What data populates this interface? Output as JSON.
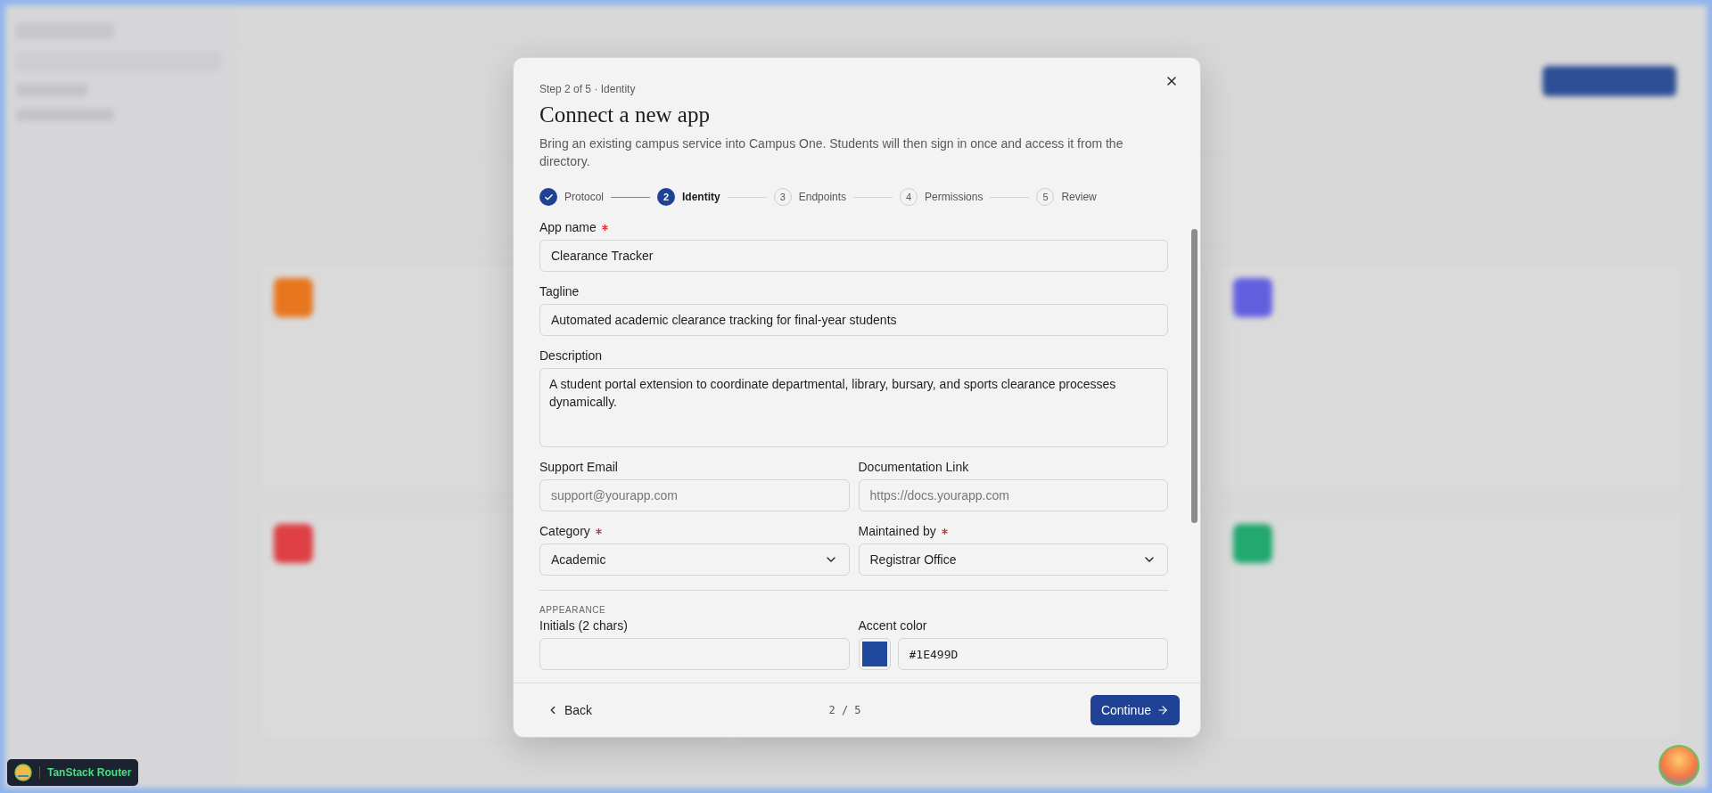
{
  "modal": {
    "step_label": "Step 2 of 5 · Identity",
    "title": "Connect a new app",
    "description": "Bring an existing campus service into Campus One. Students will then sign in once and access it from the directory.",
    "steps": [
      {
        "label": "Protocol",
        "done": true,
        "selected": false
      },
      {
        "number": "2",
        "label": "Identity",
        "done": false,
        "selected": true
      },
      {
        "number": "3",
        "label": "Endpoints",
        "done": false,
        "selected": false
      },
      {
        "number": "4",
        "label": "Permissions",
        "done": false,
        "selected": false
      },
      {
        "number": "5",
        "label": "Review",
        "done": false,
        "selected": false
      }
    ],
    "rows": [
      [
        {
          "kind": "text",
          "label": "App name",
          "required": true,
          "value": "Clearance Tracker"
        }
      ],
      [
        {
          "kind": "text",
          "label": "Tagline",
          "required": false,
          "value": "Automated academic clearance tracking for final-year students"
        }
      ],
      [
        {
          "kind": "textarea",
          "label": "Description",
          "required": false,
          "value": "A student portal extension to coordinate departmental, library, bursary, and sports clearance processes dynamically."
        }
      ],
      [
        {
          "kind": "text",
          "label": "Support Email",
          "required": false,
          "placeholder": "support@yourapp.com"
        },
        {
          "kind": "text",
          "label": "Documentation Link",
          "required": false,
          "placeholder": "https://docs.yourapp.com"
        }
      ],
      [
        {
          "kind": "select",
          "label": "Category",
          "required": true,
          "value": "Academic"
        },
        {
          "kind": "select",
          "label": "Maintained by",
          "required": true,
          "value": "Registrar Office"
        }
      ]
    ],
    "section": "APPEARANCE",
    "appearance_rows": [
      [
        {
          "kind": "text",
          "label": "Initials (2 chars)",
          "required": false
        },
        {
          "kind": "color",
          "label": "Accent color",
          "required": false,
          "color": "#1e499d",
          "value": "#1E499D"
        }
      ]
    ],
    "footer": {
      "back": "Back",
      "page": "2 / 5",
      "continue": "Continue"
    }
  },
  "devtools_badge": {
    "label": "TanStack Router"
  }
}
